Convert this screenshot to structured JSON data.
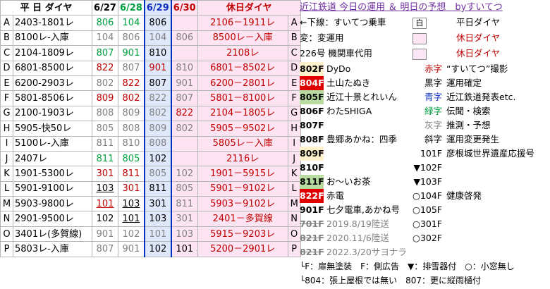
{
  "header": {
    "col_weekday": "平 日 ダイヤ",
    "dates": [
      "6/27",
      "6/28",
      "6/29",
      "6/30"
    ],
    "col_holiday": "休日ダイヤ"
  },
  "rows": [
    {
      "code": "A",
      "op": "2403-1801レ",
      "d1": "806",
      "d2": "104",
      "d3": "806",
      "d4": "",
      "hol": "2106－1911レ",
      "code2": "A"
    },
    {
      "code": "B",
      "op": "8100レ-入庫",
      "d1": "104",
      "d2": "806",
      "d3": "104",
      "d4": "806",
      "hol": "8500レ－入庫",
      "code2": "B"
    },
    {
      "code": "C",
      "op": "2104-1809レ",
      "d1": "807",
      "d2": "901",
      "d3": "810",
      "d4": "",
      "hol": "2108レ",
      "code2": "C"
    },
    {
      "code": "D",
      "op": "6801-8500レ",
      "d1": "822",
      "d2": "807",
      "d3": "901",
      "d4": "810",
      "hol": "6801－8502レ",
      "code2": "D"
    },
    {
      "code": "E",
      "op": "6200-2903レ",
      "d1": "802",
      "d2": "822",
      "d3": "807",
      "d4": "901",
      "hol": "6200－2801レ",
      "code2": "E"
    },
    {
      "code": "F",
      "op": "5801-8506レ",
      "d1": "809",
      "d2": "802",
      "d3": "822",
      "d4": "807",
      "hol": "5801－8100レ",
      "code2": "F"
    },
    {
      "code": "G",
      "op": "2100-1903レ",
      "d1": "808",
      "d2": "809",
      "d3": "802",
      "d4": "822",
      "hol": "2104－1805レ",
      "code2": "G"
    },
    {
      "code": "H",
      "op": "5905-快50レ",
      "d1": "805",
      "d2": "808",
      "d3": "809",
      "d4": "802",
      "hol": "5905－9502レ",
      "code2": "H"
    },
    {
      "code": "I",
      "op": "5100レ-入庫",
      "d1": "811",
      "d2": "810",
      "d3": "808",
      "d4": "",
      "hol": "5805レ－入庫",
      "code2": "I"
    },
    {
      "code": "J",
      "op": "2407レ",
      "d1": "811",
      "d2": "805",
      "d3": "102",
      "d4": "",
      "hol": "2116レ",
      "code2": "J"
    },
    {
      "code": "K",
      "op": "1901-5300レ",
      "d1": "301",
      "d2": "811",
      "d3": "805",
      "d4": "102",
      "hol": "1901－5915レ",
      "code2": "K"
    },
    {
      "code": "L",
      "op": "5901-9100レ",
      "d1": "103",
      "d2": "301",
      "d3": "811",
      "d4": "805",
      "hol": "5901－9102レ",
      "code2": "L"
    },
    {
      "code": "M",
      "op": "5903-9800レ",
      "d1": "101",
      "d2": "103",
      "d3": "301",
      "d4": "811",
      "hol": "5903－9102レ",
      "code2": "M"
    },
    {
      "code": "N",
      "op": "2901-9500レ",
      "d1": "102",
      "d2": "101",
      "d3": "103",
      "d4": "301",
      "hol": "2401－多賀線",
      "code2": "N"
    },
    {
      "code": "O",
      "op": "3401レ(多賀線)",
      "d1": "901",
      "d2": "102",
      "d3": "101",
      "d4": "103",
      "hol": "5915－9203レ",
      "code2": "O"
    },
    {
      "code": "P",
      "op": "5803レ-入庫",
      "d1": "807",
      "d2": "901",
      "d3": "102",
      "d4": "101",
      "hol": "5200－2901レ",
      "code2": "P"
    }
  ],
  "panel": {
    "title": "近江鉄道 今日の運用 ＆ 明日の予想　byすいてつ",
    "legend": [
      {
        "label": "←下線：すいてつ乗車",
        "box": "白",
        "desc": "平日ダイヤ"
      },
      {
        "label": "変：変運用",
        "box": "",
        "desc": "休日ダイヤ"
      },
      {
        "label": "226号 機関車代用",
        "box": "",
        "desc": "休日ダイヤ"
      }
    ],
    "cars": [
      {
        "badge": "802F",
        "name": "DyDo",
        "tag": "赤字",
        "tagdesc": "“すいてつ”撮影"
      },
      {
        "badge": "804F",
        "name": "土山たぬき",
        "tag": "黒字",
        "tagdesc": "運用確定"
      },
      {
        "badge": "805F",
        "name": "近江十景とれいん",
        "tag": "青字",
        "tagdesc": "近江鉄道発表etc."
      },
      {
        "badge": "806F",
        "name": "わたSHIGA",
        "tag": "緑字",
        "tagdesc": "伝聞・検索"
      },
      {
        "badge": "807F",
        "name": "",
        "tag": "灰字",
        "tagdesc": "推測・予想"
      },
      {
        "badge": "808F",
        "name": "豊郷あかね：四季",
        "tag": "斜字",
        "tagdesc": "運用変更発生"
      },
      {
        "badge": "809F",
        "name": "",
        "tag": "101F",
        "tagdesc": "彦根城世界遺産応援号"
      },
      {
        "badge": "810F",
        "name": "",
        "tag": "▼102F",
        "tagdesc": ""
      },
      {
        "badge": "811F",
        "name": "お〜いお茶",
        "tag": "▼103F",
        "tagdesc": ""
      },
      {
        "badge": "822F",
        "name": "赤電",
        "tag": "○104F",
        "tagdesc": "健康啓発"
      },
      {
        "badge": "901F",
        "name": "七夕電車,あかね号",
        "tag": "○105F",
        "tagdesc": ""
      },
      {
        "badge": "701F",
        "name": "2019.8/19陸送",
        "tag": "○301F",
        "tagdesc": ""
      },
      {
        "badge": "821F",
        "name": "2020.11/6陸送",
        "tag": "○302F",
        "tagdesc": ""
      },
      {
        "badge": "821F",
        "name": "2022.3/20サヨナラ",
        "tag": "",
        "tagdesc": ""
      }
    ],
    "footnote1": "└F：扉無塗装　F：側広告　▼：排雪器付　○：小窓無し",
    "footnote2": "└804：張上屋根では無い　807：更に縦雨樋付"
  }
}
